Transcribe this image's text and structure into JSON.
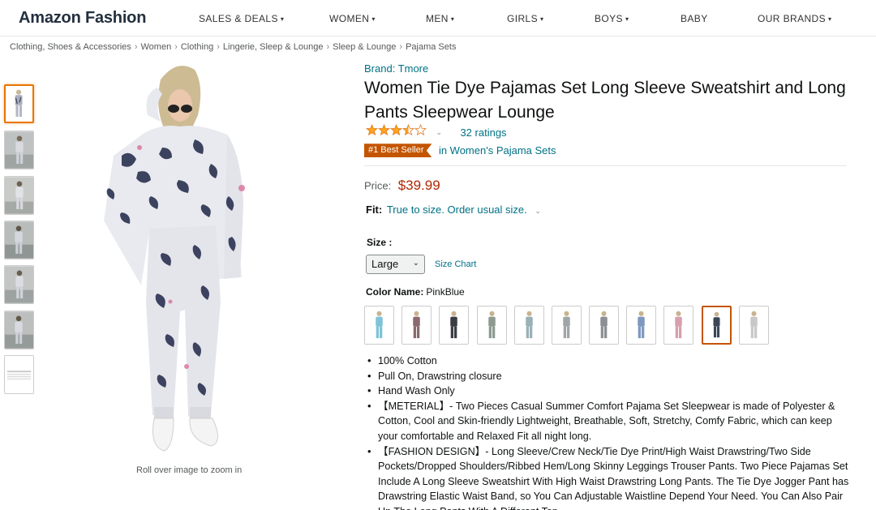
{
  "header": {
    "brand": "Amazon Fashion",
    "nav": [
      {
        "label": "SALES & DEALS",
        "caret": true
      },
      {
        "label": "WOMEN",
        "caret": true
      },
      {
        "label": "MEN",
        "caret": true
      },
      {
        "label": "GIRLS",
        "caret": true
      },
      {
        "label": "BOYS",
        "caret": true
      },
      {
        "label": "BABY",
        "caret": false
      },
      {
        "label": "OUR BRANDS",
        "caret": true
      }
    ]
  },
  "breadcrumb": [
    "Clothing, Shoes & Accessories",
    "Women",
    "Clothing",
    "Lingerie, Sleep & Lounge",
    "Sleep & Lounge",
    "Pajama Sets"
  ],
  "gallery": {
    "thumb_count": 7,
    "selected_thumb": 0,
    "zoom_hint": "Roll over image to zoom in"
  },
  "product": {
    "brand": "Brand: Tmore",
    "title": "Women Tie Dye Pajamas Set Long Sleeve Sweatshirt and Long Pants Sleepwear Lounge",
    "rating": 3.5,
    "ratings_count": "32 ratings",
    "badge": "#1 Best Seller",
    "badge_category": "in Women's Pajama Sets",
    "price_label": "Price:",
    "price": "$39.99",
    "fit_label": "Fit:",
    "fit_value": "True to size. Order usual size.",
    "size_label": "Size :",
    "size_selected": "Large",
    "size_chart": "Size Chart",
    "color_label": "Color Name:",
    "color_value": "PinkBlue",
    "swatch_count": 11,
    "selected_swatch": 9,
    "bullets": [
      "100% Cotton",
      "Pull On, Drawstring closure",
      "Hand Wash Only",
      "【METERIAL】- Two Pieces Casual Summer Comfort Pajama Set Sleepwear is made of Polyester & Cotton, Cool and Skin-friendly Lightweight, Breathable, Soft, Stretchy, Comfy Fabric, which can keep your comfortable and Relaxed Fit all night long.",
      "【FASHION DESIGN】- Long Sleeve/Crew Neck/Tie Dye Print/High Waist Drawstring/Two Side Pockets/Dropped Shoulders/Ribbed Hem/Long Skinny Leggings Trouser Pants. Two Piece Pajamas Set Include A Long Sleeve Sweatshirt With High Waist Drawstring Long Pants. The Tie Dye Jogger Pant has Drawstring Elastic Waist Band, so You Can Adjustable Waistline Depend Your Need. You Can Also Pair Up The Long Pants With A Different Top."
    ]
  },
  "colors": {
    "link": "#007185",
    "price": "#B12704",
    "badge": "#C45500",
    "star": "#FFA41C",
    "selected_thumb": "#E77600",
    "swatch_tints": [
      "#7fc4d6",
      "#8a6a6e",
      "#3a3d44",
      "#8e9a90",
      "#9ab0b8",
      "#a0a5a8",
      "#8c8f93",
      "#7f98c0",
      "#d6a0ac",
      "#3b4658",
      "#c8c8c8"
    ]
  }
}
